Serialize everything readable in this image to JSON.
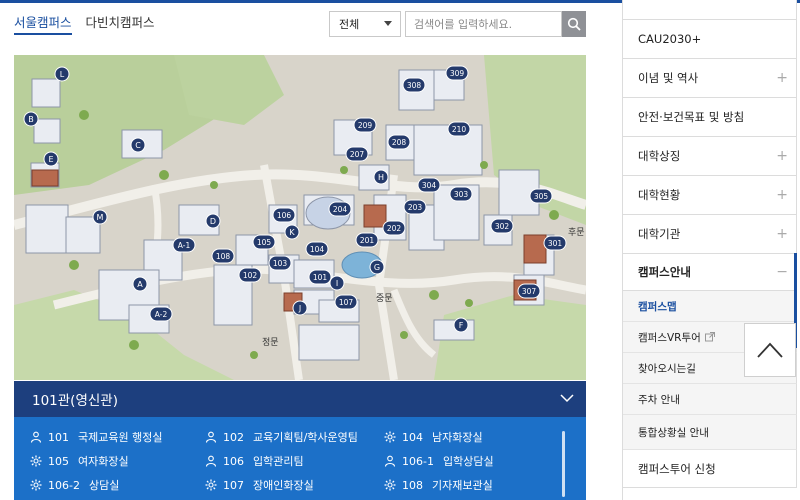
{
  "campus_tabs": [
    {
      "label": "서울캠퍼스",
      "active": true
    },
    {
      "label": "다빈치캠퍼스",
      "active": false
    }
  ],
  "search": {
    "select_value": "전체",
    "placeholder": "검색어를 입력하세요.",
    "value": ""
  },
  "map": {
    "markers": [
      "L",
      "B",
      "E",
      "C",
      "D",
      "M",
      "A-1",
      "A",
      "A-2",
      "108",
      "105",
      "106",
      "K",
      "102",
      "103",
      "104",
      "101",
      "I",
      "J",
      "107",
      "G",
      "201",
      "202",
      "203",
      "204",
      "H",
      "207",
      "208",
      "209",
      "210",
      "308",
      "309",
      "304",
      "303",
      "302",
      "305",
      "301",
      "307",
      "F"
    ],
    "labels": {
      "north_gate": "후문",
      "main_gate": "정문",
      "center_gate": "중문"
    }
  },
  "building": {
    "title": "101관(영신관)",
    "rooms": [
      {
        "icon": "person-icon",
        "number": "101",
        "name": "국제교육원 행정실"
      },
      {
        "icon": "person-icon",
        "number": "102",
        "name": "교육기획팀/학사운영팀"
      },
      {
        "icon": "gear-icon",
        "number": "104",
        "name": "남자화장실"
      },
      {
        "icon": "gear-icon",
        "number": "105",
        "name": "여자화장실"
      },
      {
        "icon": "person-icon",
        "number": "106",
        "name": "입학관리팀"
      },
      {
        "icon": "person-icon",
        "number": "106-1",
        "name": "입학상담실"
      },
      {
        "icon": "gear-icon",
        "number": "106-2",
        "name": "상담실"
      },
      {
        "icon": "gear-icon",
        "number": "107",
        "name": "장애인화장실"
      },
      {
        "icon": "gear-icon",
        "number": "108",
        "name": "기자재보관실"
      }
    ]
  },
  "sidebar": {
    "items": [
      {
        "label": "CAU2030+",
        "plus": false
      },
      {
        "label": "이념 및 역사",
        "plus": true
      },
      {
        "label": "안전·보건목표 및 방침",
        "plus": false
      },
      {
        "label": "대학상징",
        "plus": true
      },
      {
        "label": "대학현황",
        "plus": true
      },
      {
        "label": "대학기관",
        "plus": true
      },
      {
        "label": "캠퍼스안내",
        "open": true
      }
    ],
    "sub_items": [
      {
        "label": "캠퍼스맵",
        "active": true
      },
      {
        "label": "캠퍼스VR투어",
        "external": true
      },
      {
        "label": "찾아오시는길"
      },
      {
        "label": "주차 안내"
      },
      {
        "label": "통합상황실 안내"
      }
    ],
    "last_item": "캠퍼스투어 신청",
    "minus_symbol": "−",
    "plus_symbol": "+"
  },
  "colors": {
    "primary": "#1a4fa0",
    "panel_header": "#1d3f7e",
    "panel_body": "#1c70c8",
    "marker": "#243a6b"
  }
}
